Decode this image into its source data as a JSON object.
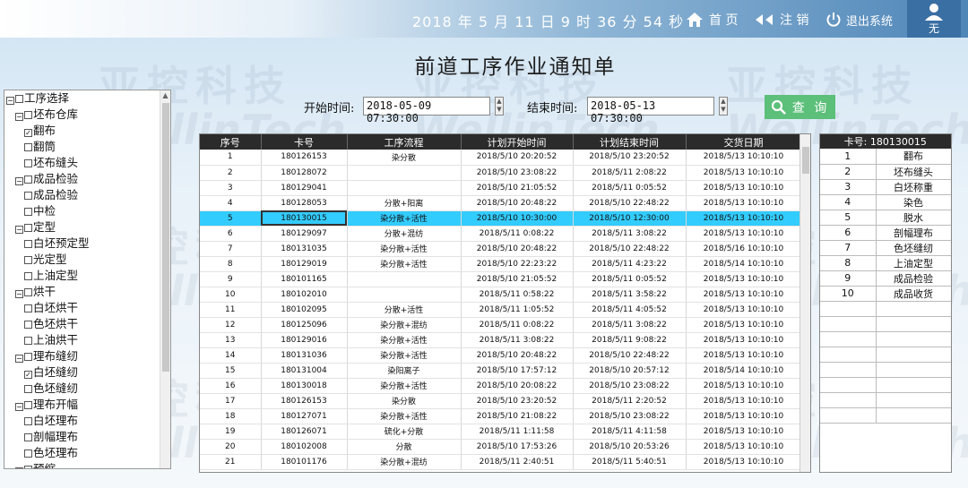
{
  "header": {
    "datetime": "2018 年 5 月 11 日  9 时 36 分 54 秒",
    "home_label": "首 页",
    "logout_label": "注 销",
    "exit_label": "退出系统",
    "user_label": "无"
  },
  "watermark": {
    "cn": "亚控科技",
    "en": "WellinTech"
  },
  "page_title": "前道工序作业通知单",
  "filter": {
    "start_label": "开始时间:",
    "start_value": "2018-05-09 07:30:00",
    "end_label": "结束时间:",
    "end_value": "2018-05-13 07:30:00",
    "query_label": "查 询"
  },
  "tree": [
    {
      "t": "工序选择",
      "lvl": 0,
      "exp": true,
      "chk": false
    },
    {
      "t": "坯布仓库",
      "lvl": 1,
      "exp": true,
      "chk": false
    },
    {
      "t": "翻布",
      "lvl": 2,
      "chk": true
    },
    {
      "t": "翻筒",
      "lvl": 2,
      "chk": false
    },
    {
      "t": "坯布缝头",
      "lvl": 2,
      "chk": false
    },
    {
      "t": "成品检验",
      "lvl": 1,
      "exp": true,
      "chk": false
    },
    {
      "t": "成品检验",
      "lvl": 2,
      "chk": false
    },
    {
      "t": "中检",
      "lvl": 2,
      "chk": false
    },
    {
      "t": "定型",
      "lvl": 1,
      "exp": true,
      "chk": false
    },
    {
      "t": "白坯预定型",
      "lvl": 2,
      "chk": false
    },
    {
      "t": "光定型",
      "lvl": 2,
      "chk": false
    },
    {
      "t": "上油定型",
      "lvl": 2,
      "chk": false
    },
    {
      "t": "烘干",
      "lvl": 1,
      "exp": true,
      "chk": false
    },
    {
      "t": "白坯烘干",
      "lvl": 2,
      "chk": false
    },
    {
      "t": "色坯烘干",
      "lvl": 2,
      "chk": false
    },
    {
      "t": "上油烘干",
      "lvl": 2,
      "chk": false
    },
    {
      "t": "理布缝纫",
      "lvl": 1,
      "exp": true,
      "chk": false
    },
    {
      "t": "白坯缝纫",
      "lvl": 2,
      "chk": true
    },
    {
      "t": "色坯缝纫",
      "lvl": 2,
      "chk": false
    },
    {
      "t": "理布开幅",
      "lvl": 1,
      "exp": true,
      "chk": false
    },
    {
      "t": "白坯理布",
      "lvl": 2,
      "chk": false
    },
    {
      "t": "剖幅理布",
      "lvl": 2,
      "chk": false
    },
    {
      "t": "色坯理布",
      "lvl": 2,
      "chk": false
    },
    {
      "t": "预缩",
      "lvl": 1,
      "exp": true,
      "chk": false
    }
  ],
  "table": {
    "headers": [
      "序号",
      "卡号",
      "工序流程",
      "计划开始时间",
      "计划结束时间",
      "交货日期"
    ],
    "rows": [
      [
        "1",
        "180126153",
        "染分散",
        "2018/5/10 20:20:52",
        "2018/5/10 23:20:52",
        "2018/5/13 10:10:10"
      ],
      [
        "2",
        "180128072",
        "",
        "2018/5/10 23:08:22",
        "2018/5/11 2:08:22",
        "2018/5/13 10:10:10"
      ],
      [
        "3",
        "180129041",
        "",
        "2018/5/10 21:05:52",
        "2018/5/11 0:05:52",
        "2018/5/13 10:10:10"
      ],
      [
        "4",
        "180128053",
        "分散+阳离",
        "2018/5/10 20:48:22",
        "2018/5/10 22:48:22",
        "2018/5/13 10:10:10"
      ],
      [
        "5",
        "180130015",
        "染分散+活性",
        "2018/5/10 10:30:00",
        "2018/5/10 12:30:00",
        "2018/5/13 10:10:10"
      ],
      [
        "6",
        "180129097",
        "分散+混纺",
        "2018/5/11 0:08:22",
        "2018/5/11 3:08:22",
        "2018/5/13 10:10:10"
      ],
      [
        "7",
        "180131035",
        "染分散+活性",
        "2018/5/10 20:48:22",
        "2018/5/10 22:48:22",
        "2018/5/16 10:10:10"
      ],
      [
        "8",
        "180129019",
        "染分散+活性",
        "2018/5/10 22:23:22",
        "2018/5/11 4:23:22",
        "2018/5/14 10:10:10"
      ],
      [
        "9",
        "180101165",
        "",
        "2018/5/10 21:05:52",
        "2018/5/11 0:05:52",
        "2018/5/13 10:10:10"
      ],
      [
        "10",
        "180102010",
        "",
        "2018/5/11 0:58:22",
        "2018/5/11 3:58:22",
        "2018/5/13 10:10:10"
      ],
      [
        "11",
        "180102095",
        "分散+活性",
        "2018/5/11 1:05:52",
        "2018/5/11 4:05:52",
        "2018/5/13 10:10:10"
      ],
      [
        "12",
        "180125096",
        "染分散+混纺",
        "2018/5/11 0:08:22",
        "2018/5/11 3:08:22",
        "2018/5/13 10:10:10"
      ],
      [
        "13",
        "180129016",
        "染分散+活性",
        "2018/5/11 3:08:22",
        "2018/5/11 9:08:22",
        "2018/5/13 10:10:10"
      ],
      [
        "14",
        "180131036",
        "染分散+活性",
        "2018/5/10 20:48:22",
        "2018/5/10 22:48:22",
        "2018/5/13 10:10:10"
      ],
      [
        "15",
        "180131004",
        "染阳离子",
        "2018/5/10 17:57:12",
        "2018/5/10 20:57:12",
        "2018/5/14 10:10:10"
      ],
      [
        "16",
        "180130018",
        "染分散+活性",
        "2018/5/10 20:08:22",
        "2018/5/10 23:08:22",
        "2018/5/13 10:10:10"
      ],
      [
        "17",
        "180126153",
        "染分散",
        "2018/5/10 23:20:52",
        "2018/5/11 2:20:52",
        "2018/5/13 10:10:10"
      ],
      [
        "18",
        "180127071",
        "染分散+活性",
        "2018/5/10 21:08:22",
        "2018/5/10 23:08:22",
        "2018/5/13 10:10:10"
      ],
      [
        "19",
        "180126071",
        "硫化+分散",
        "2018/5/11 1:11:58",
        "2018/5/11 4:11:58",
        "2018/5/13 10:10:10"
      ],
      [
        "20",
        "180102008",
        "分散",
        "2018/5/10 17:53:26",
        "2018/5/10 20:53:26",
        "2018/5/13 10:10:10"
      ],
      [
        "21",
        "180101176",
        "染分散+混纺",
        "2018/5/11 2:40:51",
        "2018/5/11 5:40:51",
        "2018/5/13 10:10:10"
      ]
    ],
    "selected_index": 4
  },
  "side": {
    "header": "卡号:  180130015",
    "rows": [
      [
        "1",
        "翻布"
      ],
      [
        "2",
        "坯布缝头"
      ],
      [
        "3",
        "白坯称重"
      ],
      [
        "4",
        "染色"
      ],
      [
        "5",
        "脱水"
      ],
      [
        "6",
        "剖幅理布"
      ],
      [
        "7",
        "色坯缝纫"
      ],
      [
        "8",
        "上油定型"
      ],
      [
        "9",
        "成品检验"
      ],
      [
        "10",
        "成品收货"
      ]
    ],
    "empty_rows": 8
  },
  "colors": {
    "accent": "#5cbf7a",
    "selection": "#33ccff",
    "header": "#2b2b2b"
  }
}
